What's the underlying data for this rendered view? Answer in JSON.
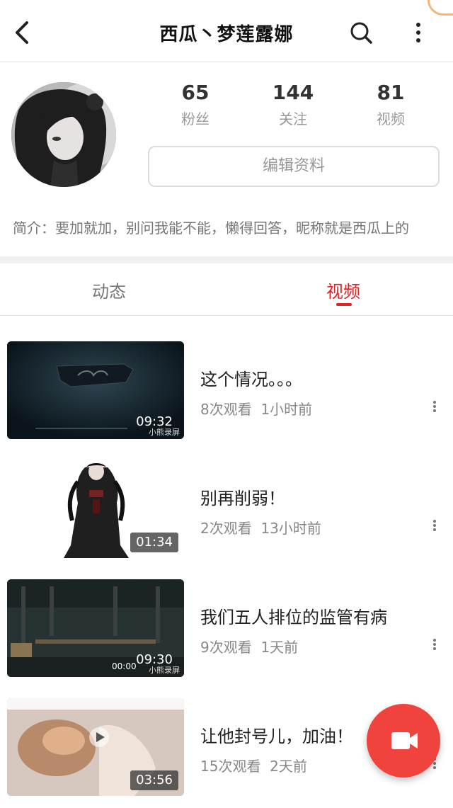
{
  "header": {
    "title": "西瓜丶梦莲露娜",
    "back_icon": "chevron-left-icon",
    "search_icon": "search-icon",
    "more_icon": "more-vertical-icon"
  },
  "profile": {
    "stats": [
      {
        "value": "65",
        "label": "粉丝"
      },
      {
        "value": "144",
        "label": "关注"
      },
      {
        "value": "81",
        "label": "视频"
      }
    ],
    "edit_label": "编辑资料",
    "bio": "简介：要加就加，别问我能不能，懒得回答，昵称就是西瓜上的"
  },
  "tabs": {
    "items": [
      {
        "label": "动态"
      },
      {
        "label": "视频"
      }
    ],
    "active_color": "#e02424"
  },
  "videos": [
    {
      "title": "这个情况。。。",
      "views": "8次观看",
      "time": "1小时前",
      "duration": "09:32",
      "watermark": "小熊录屏"
    },
    {
      "title": "别再削弱！",
      "views": "2次观看",
      "time": "13小时前",
      "duration": "01:34"
    },
    {
      "title": "我们五人排位的监管有病",
      "views": "9次观看",
      "time": "1天前",
      "duration": "09:30",
      "watermark": "小熊录屏",
      "overlay_time": "00:00"
    },
    {
      "title": "让他封号儿，加油！",
      "views": "15次观看",
      "time": "2天前",
      "duration": "03:56"
    }
  ],
  "fab": {
    "icon": "video-camera-icon",
    "color": "#f0433d"
  }
}
